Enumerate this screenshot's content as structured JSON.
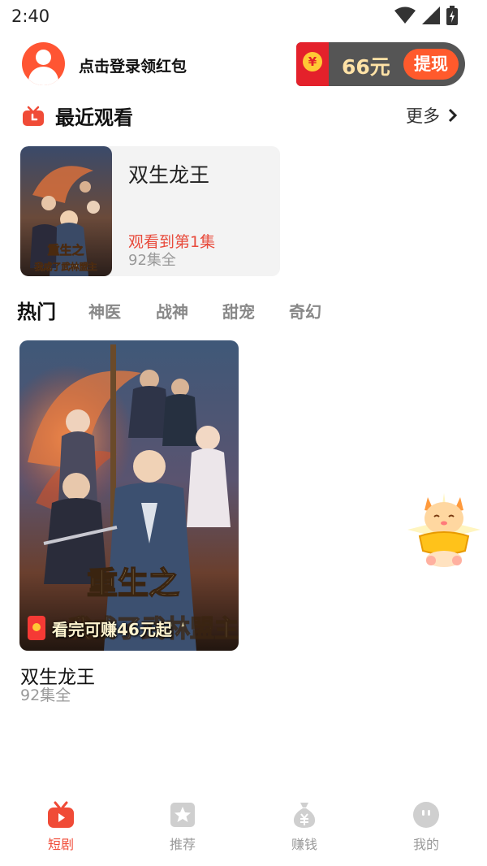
{
  "status_bar": {
    "time": "2:40"
  },
  "user": {
    "login_prompt": "点击登录领红包"
  },
  "wallet": {
    "coin_symbol": "¥",
    "amount": "66元",
    "withdraw_label": "提现"
  },
  "recent": {
    "title": "最近观看",
    "more_label": "更多",
    "item": {
      "name": "双生龙王",
      "progress": "观看到第1集",
      "episodes": "92集全"
    }
  },
  "poster": {
    "title_text_line1": "重生之",
    "title_text_line2": "我成了武林盟主"
  },
  "tabs": [
    {
      "label": "热门"
    },
    {
      "label": "神医"
    },
    {
      "label": "战神"
    },
    {
      "label": "甜宠"
    },
    {
      "label": "奇幻"
    }
  ],
  "drama": {
    "name": "双生龙王",
    "episodes": "92集全",
    "reward_text": "看完可赚46元起"
  },
  "bottom_nav": [
    {
      "label": "短剧"
    },
    {
      "label": "推荐"
    },
    {
      "label": "赚钱"
    },
    {
      "label": "我的"
    }
  ],
  "colors": {
    "accent": "#f04b37",
    "wallet_bg": "#555555",
    "withdraw": "#ff5a2c"
  }
}
